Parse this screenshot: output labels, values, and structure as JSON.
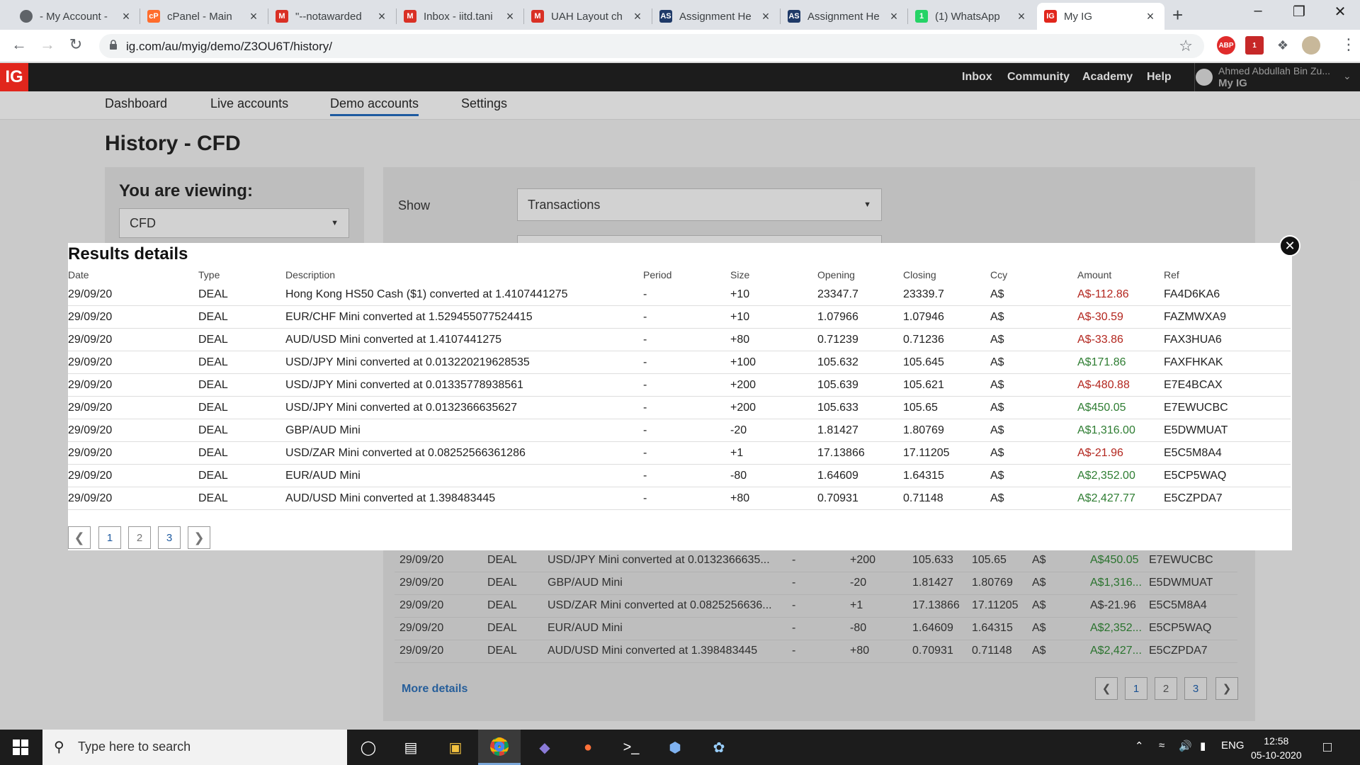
{
  "browser": {
    "tabs": [
      {
        "title": "- My Account -",
        "icon": "globe-icon",
        "color": "#5f6368",
        "glyph": ""
      },
      {
        "title": "cPanel - Main",
        "icon": "cpanel-icon",
        "color": "#ff6c2c",
        "glyph": "cP"
      },
      {
        "title": "\"--notawarded",
        "icon": "gmail-icon",
        "color": "#d93025",
        "glyph": "M"
      },
      {
        "title": "Inbox - iitd.tani",
        "icon": "gmail-icon",
        "color": "#d93025",
        "glyph": "M"
      },
      {
        "title": "UAH Layout ch",
        "icon": "gmail-icon",
        "color": "#d93025",
        "glyph": "M"
      },
      {
        "title": "Assignment He",
        "icon": "assignment-icon",
        "color": "#1f3a68",
        "glyph": "AS"
      },
      {
        "title": "Assignment He",
        "icon": "assignment-icon",
        "color": "#1f3a68",
        "glyph": "AS"
      },
      {
        "title": "(1) WhatsApp",
        "icon": "whatsapp-icon",
        "color": "#25d366",
        "glyph": "1"
      },
      {
        "title": "My IG",
        "icon": "ig-icon",
        "color": "#e1261c",
        "glyph": "IG"
      }
    ],
    "url": "ig.com/au/myig/demo/Z3OU6T/history/"
  },
  "header": {
    "logo": "IG",
    "nav": [
      "Inbox",
      "Community",
      "Academy",
      "Help"
    ],
    "user_name": "Ahmed Abdullah Bin Zu...",
    "user_account": "My IG"
  },
  "subnav": [
    "Dashboard",
    "Live accounts",
    "Demo accounts",
    "Settings"
  ],
  "page": {
    "title": "History - CFD",
    "viewing_label": "You are viewing:",
    "viewing_value": "CFD",
    "show_label": "Show",
    "show_value": "Transactions",
    "more_details": "More details"
  },
  "background_rows": [
    [
      "29/09/20",
      "DEAL",
      "USD/JPY Mini converted at 0.0132366635...",
      "-",
      "+200",
      "105.633",
      "105.65",
      "A$",
      "A$450.05",
      "E7EWUCBC",
      "pos"
    ],
    [
      "29/09/20",
      "DEAL",
      "GBP/AUD Mini",
      "-",
      "-20",
      "1.81427",
      "1.80769",
      "A$",
      "A$1,316...",
      "E5DWMUAT",
      "pos"
    ],
    [
      "29/09/20",
      "DEAL",
      "USD/ZAR Mini converted at 0.0825256636...",
      "-",
      "+1",
      "17.13866",
      "17.11205",
      "A$",
      "A$-21.96",
      "E5C5M8A4",
      "neg"
    ],
    [
      "29/09/20",
      "DEAL",
      "EUR/AUD Mini",
      "-",
      "-80",
      "1.64609",
      "1.64315",
      "A$",
      "A$2,352...",
      "E5CP5WAQ",
      "pos"
    ],
    [
      "29/09/20",
      "DEAL",
      "AUD/USD Mini converted at 1.398483445",
      "-",
      "+80",
      "0.70931",
      "0.71148",
      "A$",
      "A$2,427...",
      "E5CZPDA7",
      "pos"
    ]
  ],
  "modal": {
    "title": "Results details",
    "columns": [
      "Date",
      "Type",
      "Description",
      "Period",
      "Size",
      "Opening",
      "Closing",
      "Ccy",
      "Amount",
      "Ref"
    ],
    "rows": [
      [
        "29/09/20",
        "DEAL",
        "Hong Kong HS50 Cash ($1) converted at 1.4107441275",
        "-",
        "+10",
        "23347.7",
        "23339.7",
        "A$",
        "A$-112.86",
        "FA4D6KA6",
        "neg"
      ],
      [
        "29/09/20",
        "DEAL",
        "EUR/CHF Mini converted at 1.529455077524415",
        "-",
        "+10",
        "1.07966",
        "1.07946",
        "A$",
        "A$-30.59",
        "FAZMWXA9",
        "neg"
      ],
      [
        "29/09/20",
        "DEAL",
        "AUD/USD Mini converted at 1.4107441275",
        "-",
        "+80",
        "0.71239",
        "0.71236",
        "A$",
        "A$-33.86",
        "FAX3HUA6",
        "neg"
      ],
      [
        "29/09/20",
        "DEAL",
        "USD/JPY Mini converted at 0.013220219628535",
        "-",
        "+100",
        "105.632",
        "105.645",
        "A$",
        "A$171.86",
        "FAXFHKAK",
        "pos"
      ],
      [
        "29/09/20",
        "DEAL",
        "USD/JPY Mini converted at 0.01335778938561",
        "-",
        "+200",
        "105.639",
        "105.621",
        "A$",
        "A$-480.88",
        "E7E4BCAX",
        "neg"
      ],
      [
        "29/09/20",
        "DEAL",
        "USD/JPY Mini converted at 0.0132366635627",
        "-",
        "+200",
        "105.633",
        "105.65",
        "A$",
        "A$450.05",
        "E7EWUCBC",
        "pos"
      ],
      [
        "29/09/20",
        "DEAL",
        "GBP/AUD Mini",
        "-",
        "-20",
        "1.81427",
        "1.80769",
        "A$",
        "A$1,316.00",
        "E5DWMUAT",
        "pos"
      ],
      [
        "29/09/20",
        "DEAL",
        "USD/ZAR Mini converted at 0.08252566361286",
        "-",
        "+1",
        "17.13866",
        "17.11205",
        "A$",
        "A$-21.96",
        "E5C5M8A4",
        "neg"
      ],
      [
        "29/09/20",
        "DEAL",
        "EUR/AUD Mini",
        "-",
        "-80",
        "1.64609",
        "1.64315",
        "A$",
        "A$2,352.00",
        "E5CP5WAQ",
        "pos"
      ],
      [
        "29/09/20",
        "DEAL",
        "AUD/USD Mini converted at 1.398483445",
        "-",
        "+80",
        "0.70931",
        "0.71148",
        "A$",
        "A$2,427.77",
        "E5CZPDA7",
        "pos"
      ]
    ],
    "pages": [
      "1",
      "2",
      "3"
    ],
    "close_glyph": "✕"
  },
  "taskbar": {
    "search_placeholder": "Type here to search",
    "language": "ENG",
    "time": "12:58",
    "date": "05-10-2020"
  },
  "colors": {
    "positive": "#2e7d32",
    "negative": "#b3261e",
    "link": "#1e5aa0",
    "brand": "#e1261c"
  }
}
